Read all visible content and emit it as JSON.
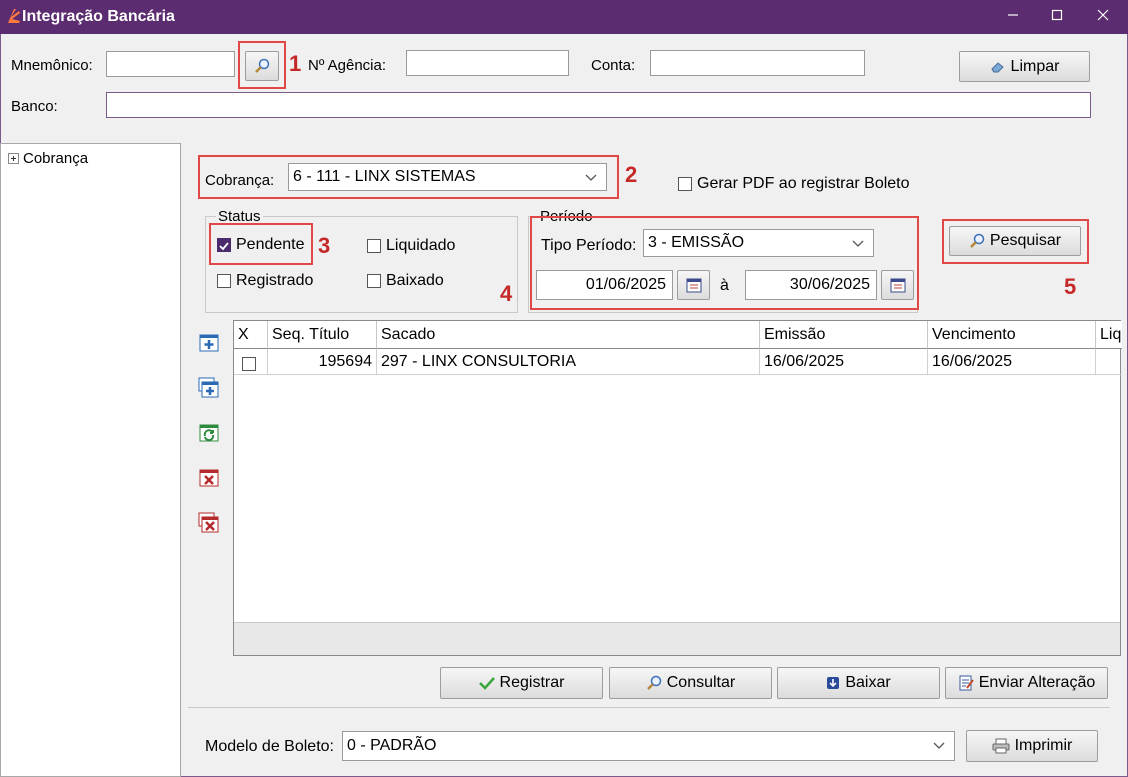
{
  "window": {
    "title": "Integração Bancária"
  },
  "header": {
    "mnemonico_label": "Mnemônico:",
    "mnemonico_value": "",
    "agencia_label": "Nº Agência:",
    "agencia_value": "",
    "conta_label": "Conta:",
    "conta_value": "",
    "banco_label": "Banco:",
    "banco_value": "",
    "limpar_label": "Limpar"
  },
  "annotations": {
    "n1": "1",
    "n2": "2",
    "n3": "3",
    "n4": "4",
    "n5": "5"
  },
  "tree": {
    "root_label": "Cobrança"
  },
  "filters": {
    "cobranca_label": "Cobrança:",
    "cobranca_value": "6 - 111 - LINX SISTEMAS",
    "gerar_pdf_label": "Gerar PDF ao registrar Boleto",
    "status_title": "Status",
    "pendente_label": "Pendente",
    "liquidado_label": "Liquidado",
    "registrado_label": "Registrado",
    "baixado_label": "Baixado",
    "periodo_title": "Período",
    "tipo_periodo_label": "Tipo Período:",
    "tipo_periodo_value": "3 - EMISSÃO",
    "data_inicio": "01/06/2025",
    "separator": "à",
    "data_fim": "30/06/2025",
    "pesquisar_label": "Pesquisar"
  },
  "grid": {
    "columns": [
      "X",
      "Seq. Título",
      "Sacado",
      "Emissão",
      "Vencimento",
      "Liq"
    ],
    "rows": [
      {
        "seq": "195694",
        "sacado": "297 - LINX CONSULTORIA",
        "emissao": "16/06/2025",
        "vencimento": "16/06/2025",
        "liq": ""
      }
    ]
  },
  "actions": {
    "registrar": "Registrar",
    "consultar": "Consultar",
    "baixar": "Baixar",
    "enviar_alteracao": "Enviar Alteração"
  },
  "footer": {
    "modelo_label": "Modelo de Boleto:",
    "modelo_value": "0 - PADRÃO",
    "imprimir_label": "Imprimir"
  },
  "colors": {
    "titlebar": "#5b2c6f",
    "highlight": "#e04848",
    "accent": "#4b2a6d"
  }
}
